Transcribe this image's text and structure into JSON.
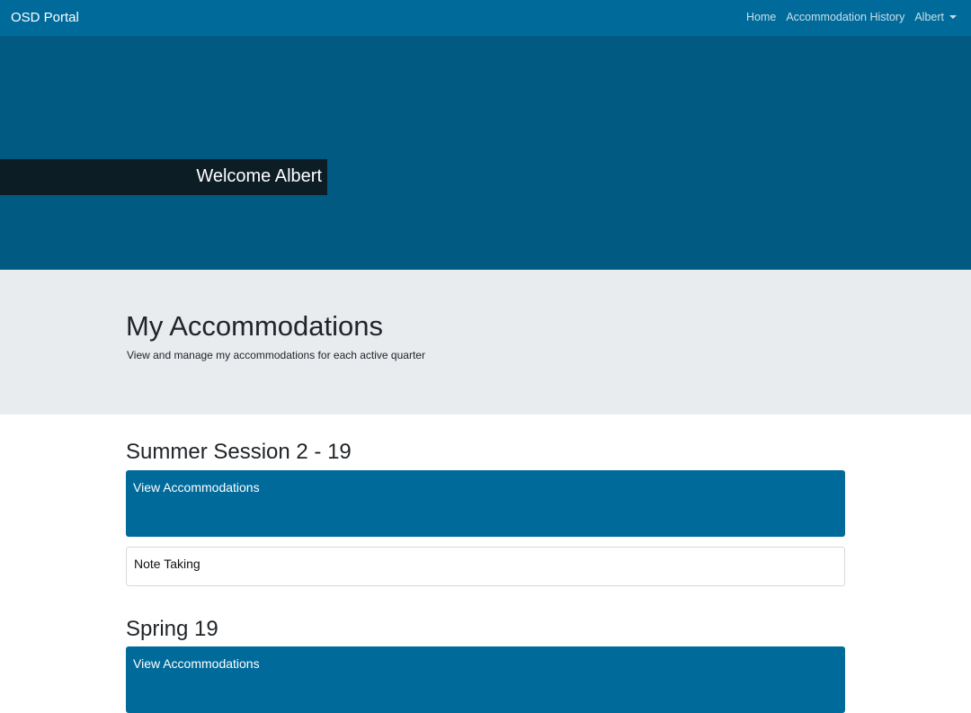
{
  "navbar": {
    "brand": "OSD Portal",
    "links": [
      "Home",
      "Accommodation History"
    ],
    "user_menu": "Albert"
  },
  "hero": {
    "welcome": "Welcome Albert"
  },
  "header": {
    "title": "My Accommodations",
    "subtitle": "View and manage my accommodations for each active quarter"
  },
  "sessions": [
    {
      "title": "Summer Session 2 - 19",
      "view_label": "View Accommodations",
      "accommodations": [
        "Note Taking"
      ]
    },
    {
      "title": "Spring 19",
      "view_label": "View Accommodations"
    }
  ],
  "colors": {
    "primary": "#006b9b",
    "hero": "#005c85",
    "jumbotron": "#e9ecef"
  }
}
